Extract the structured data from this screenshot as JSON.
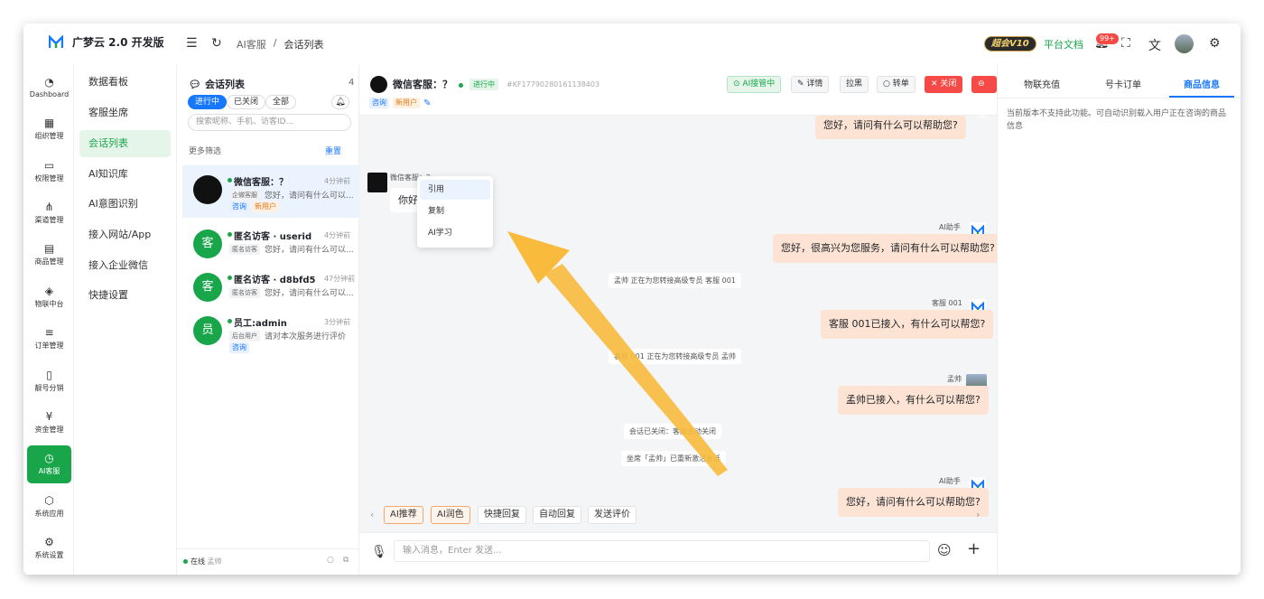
{
  "header": {
    "logo_text": "广梦云 2.0 开发版",
    "breadcrumb": [
      "AI客服",
      "会话列表"
    ],
    "vip_badge": "超会V10",
    "platform_doc": "平台文档",
    "notification_count": "99+",
    "colors": {
      "brand": "#19a64b",
      "accent": "#1677ff",
      "danger": "#f54a45"
    }
  },
  "nav": {
    "items": [
      {
        "label": "Dashboard",
        "icon": "gauge-icon"
      },
      {
        "label": "组织管理",
        "icon": "grid-icon"
      },
      {
        "label": "权限管理",
        "icon": "monitor-icon"
      },
      {
        "label": "渠道管理",
        "icon": "network-icon"
      },
      {
        "label": "商品管理",
        "icon": "store-icon"
      },
      {
        "label": "物联中台",
        "icon": "cube-icon"
      },
      {
        "label": "订单管理",
        "icon": "list-icon"
      },
      {
        "label": "靓号分销",
        "icon": "phone-icon"
      },
      {
        "label": "资金管理",
        "icon": "yuan-icon"
      },
      {
        "label": "AI客服",
        "icon": "timer-icon"
      },
      {
        "label": "系统应用",
        "icon": "box-icon"
      },
      {
        "label": "系统设置",
        "icon": "gear-icon"
      }
    ]
  },
  "submenu": {
    "items": [
      "数据看板",
      "客服坐席",
      "会话列表",
      "AI知识库",
      "AI意图识别",
      "接入网站/App",
      "接入企业微信",
      "快捷设置"
    ]
  },
  "conv_list": {
    "title": "会话列表",
    "count": "4",
    "filters": [
      "进行中",
      "已关闭",
      "全部"
    ],
    "search_placeholder": "搜索昵称、手机、访客ID...",
    "more_filter": "更多筛选",
    "reset": "重置",
    "items": [
      {
        "avatar": "",
        "name": "微信客服：？",
        "time": "4分钟前",
        "source": "企微客服",
        "message": "您好，请问有什么可以...",
        "tags": [
          "咨询",
          "新用户"
        ]
      },
      {
        "avatar": "客",
        "name": "匿名访客 · userid",
        "time": "4分钟前",
        "source": "匿名访客",
        "message": "您好，请问有什么可以...",
        "tags": []
      },
      {
        "avatar": "客",
        "name": "匿名访客 · d8bfd5",
        "time": "47分钟前",
        "source": "匿名访客",
        "message": "您好，请问有什么可以...",
        "tags": []
      },
      {
        "avatar": "员",
        "name": "员工:admin",
        "time": "3分钟前",
        "source": "后台用户",
        "message": "请对本次服务进行评价",
        "tags": [
          "咨询"
        ]
      }
    ],
    "footer": {
      "status": "在线",
      "agent": "孟帅"
    }
  },
  "chat": {
    "name": "微信客服：？",
    "status": "进行中",
    "id": "#KF17790280161138403",
    "tags": [
      "咨询",
      "新用户"
    ],
    "actions": [
      "AI接管中",
      "详情",
      "拉黑",
      "转单",
      "关闭",
      "删除"
    ],
    "messages": {
      "top_partial": "您好，请问有什么可以帮助您?",
      "user_sender": "微信客服：？",
      "user_text": "你好",
      "bot1_sender": "AI助手",
      "bot1_text": "您好，很高兴为您服务，请问有什么可以帮助您?",
      "sys1": "孟帅 正在为您转接高级专员 客服 001",
      "agent_sender": "客服 001",
      "agent_text": "客服 001已接入，有什么可以帮您?",
      "sys2": "客服 001 正在为您转接高级专员 孟帅",
      "meng_sender": "孟帅",
      "meng_text": "孟帅已接入，有什么可以帮您?",
      "sys3": "会话已关闭：客服主动关闭",
      "sys4": "坐席「孟帅」已重新激活会话",
      "bot2_sender": "AI助手",
      "bot2_text": "您好，请问有什么可以帮助您?"
    },
    "context_menu": [
      "引用",
      "复制",
      "AI学习"
    ],
    "quick_actions": [
      "AI推荐",
      "AI润色",
      "快捷回复",
      "自动回复",
      "发送评价"
    ],
    "input_placeholder": "输入消息，Enter 发送..."
  },
  "right_panel": {
    "tabs": [
      "物联充值",
      "号卡订单",
      "商品信息"
    ],
    "info": "当前版本不支持此功能。可自动识别载入用户正在咨询的商品信息"
  }
}
